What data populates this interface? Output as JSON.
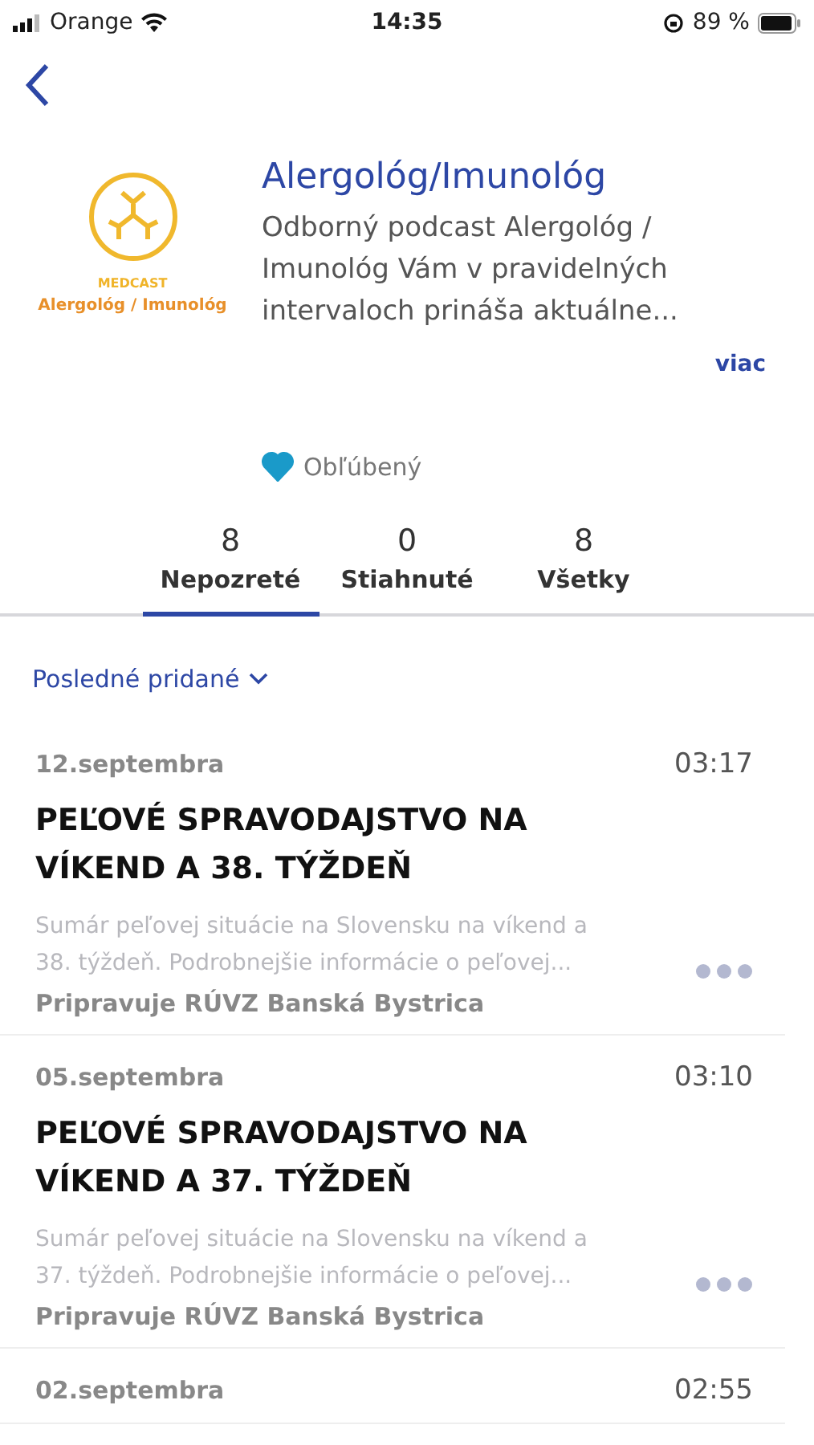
{
  "status_bar": {
    "carrier": "Orange",
    "time": "14:35",
    "battery": "89 %"
  },
  "podcast": {
    "logo_brand": "MEDCAST",
    "logo_name": "Alergológ / Imunológ",
    "title": "Alergológ/Imunológ",
    "description": "Odborný podcast Alergológ / Imunológ  Vám v pravidelných intervaloch prináša aktuálne...",
    "more": "viac",
    "favorite": {
      "label": "Obľúbený",
      "on": true
    }
  },
  "tabs": [
    {
      "count": "8",
      "label": "Nepozreté",
      "selected": true
    },
    {
      "count": "0",
      "label": "Stiahnuté",
      "selected": false
    },
    {
      "count": "8",
      "label": "Všetky",
      "selected": false
    }
  ],
  "sort": {
    "label": "Posledné pridané"
  },
  "episodes": [
    {
      "date": "12.septembra",
      "duration": "03:17",
      "title": "PEĽOVÉ SPRAVODAJSTVO NA VÍKEND A 38. TÝŽDEŇ",
      "summary": "Sumár peľovej situácie na Slovensku na víkend a 38. týždeň. Podrobnejšie informácie o peľovej...",
      "author": "Pripravuje RÚVZ Banská Bystrica"
    },
    {
      "date": "05.septembra",
      "duration": "03:10",
      "title": "PEĽOVÉ SPRAVODAJSTVO NA VÍKEND A 37. TÝŽDEŇ",
      "summary": "Sumár peľovej situácie na Slovensku na víkend a 37. týždeň. Podrobnejšie informácie o peľovej...",
      "author": "Pripravuje RÚVZ Banská Bystrica"
    },
    {
      "date": "02.septembra",
      "duration": "02:55"
    }
  ]
}
